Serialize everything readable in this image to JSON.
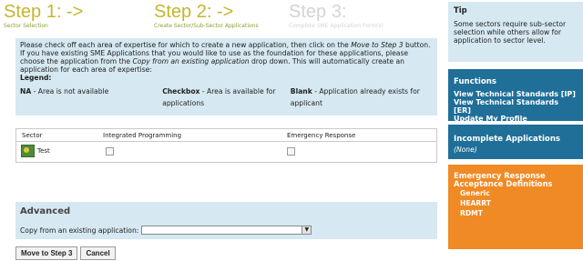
{
  "steps": [
    {
      "title": "Step 1: ->",
      "subtitle": "Sector Selection"
    },
    {
      "title": "Step 2: ->",
      "subtitle": "Create Sector/Sub-Sector Applications"
    },
    {
      "title": "Step 3:",
      "subtitle": "Complete SME Application Form(s)"
    }
  ],
  "instructions": {
    "text_1": "Please check off each area of expertise for which to create a new application, then click on the ",
    "link_step": "Move to Step 3",
    "text_2": " button. If you have existing SME Applications that you would like to use as the foundation for these applications, please choose the application from the ",
    "link_copy": "Copy from an existing application",
    "text_3": " drop down. This will automatically create an application for each area of expertise:",
    "legend_title": "Legend:",
    "legend": [
      {
        "term": "NA",
        "desc": " - Area is not available"
      },
      {
        "term": "Checkbox",
        "desc": " - Area is available for applications"
      },
      {
        "term": "Blank",
        "desc": " - Application already exists for applicant"
      }
    ]
  },
  "table": {
    "headers": [
      "Sector",
      "Integrated Programming",
      "Emergency Response"
    ],
    "rows": [
      {
        "sector": "Test"
      }
    ]
  },
  "advanced": {
    "title": "Advanced",
    "copy_label": "Copy from an existing application:",
    "copy_value": ""
  },
  "buttons": {
    "move": "Move to Step 3",
    "cancel": "Cancel"
  },
  "tip": {
    "title": "Tip",
    "text": "Some sectors require sub-sector selection while others allow for application to sector level."
  },
  "functions": {
    "title": "Functions",
    "links": [
      "View Technical Standards [IP]",
      "View Technical Standards [ER]",
      "Update My Profile"
    ]
  },
  "incomplete": {
    "title": "Incomplete Applications",
    "none": "(None)"
  },
  "era": {
    "title": "Emergency Response Acceptance Definitions",
    "links": [
      "Generic",
      "HEARRT",
      "RDMT"
    ]
  },
  "colors": {
    "panel_blue": "#1f6f99",
    "panel_orange": "#f08a24",
    "box_blue": "#d6e8f1",
    "step_active": "#c4b52c"
  }
}
